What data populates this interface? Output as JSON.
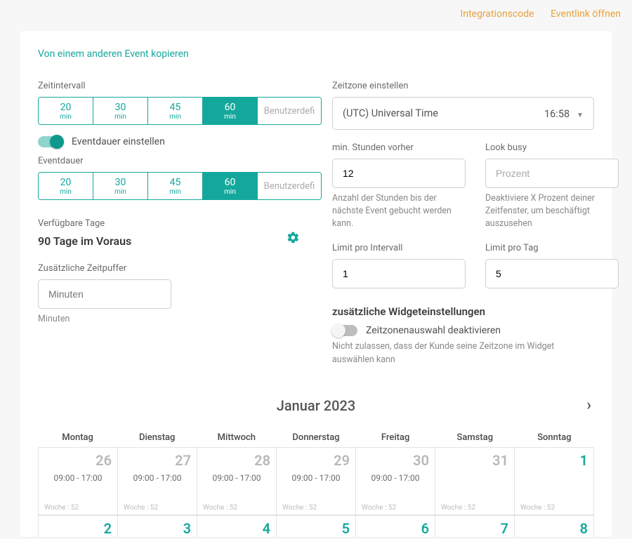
{
  "topLinks": {
    "integration": "Integrationscode",
    "openLink": "Eventlink öffnen"
  },
  "copyFrom": "Von einem anderen Event kopieren",
  "left": {
    "intervalLabel": "Zeitintervall",
    "intervalOptions": [
      "20",
      "30",
      "45",
      "60"
    ],
    "intervalSelected": 3,
    "minUnit": "min",
    "customLabel": "Benutzerdefi",
    "setDurationToggle": "Eventdauer einstellen",
    "durationLabel": "Eventdauer",
    "durationOptions": [
      "20",
      "30",
      "45",
      "60"
    ],
    "durationSelected": 3,
    "availLabel": "Verfügbare Tage",
    "availValue": "90 Tage im Voraus",
    "bufferLabel": "Zusätzliche Zeitpuffer",
    "bufferPlaceholder": "Minuten",
    "bufferSub": "Minuten"
  },
  "right": {
    "tzLabel": "Zeitzone einstellen",
    "tzValue": "(UTC) Universal Time",
    "tzTime": "16:58",
    "minHoursLabel": "min. Stunden vorher",
    "minHoursValue": "12",
    "minHoursHelp": "Anzahl der Stunden bis der nächste Event gebucht werden kann.",
    "lookBusyLabel": "Look busy",
    "lookBusyPlaceholder": "Prozent",
    "lookBusyHelp": "Deaktiviere X Prozent deiner Zeitfenster, um beschäftigt auszusehen",
    "limitIntLabel": "Limit pro Intervall",
    "limitIntValue": "1",
    "limitDayLabel": "Limit pro Tag",
    "limitDayValue": "5",
    "widgetSettings": "zusätzliche Widgeteinstellungen",
    "disableTzToggle": "Zeitzonenauswahl deaktivieren",
    "disableTzHelp": "Nicht zulassen, dass der Kunde seine Zeitzone im Widget auswählen kann"
  },
  "calendar": {
    "title": "Januar 2023",
    "dow": [
      "Montag",
      "Dienstag",
      "Mittwoch",
      "Donnerstag",
      "Freitag",
      "Samstag",
      "Sonntag"
    ],
    "week1": [
      {
        "d": "26",
        "prev": true,
        "hours": "09:00 - 17:00",
        "wk": "Woche : 52"
      },
      {
        "d": "27",
        "prev": true,
        "hours": "09:00 - 17:00",
        "wk": "Woche : 52"
      },
      {
        "d": "28",
        "prev": true,
        "hours": "09:00 - 17:00",
        "wk": "Woche : 52"
      },
      {
        "d": "29",
        "prev": true,
        "hours": "09:00 - 17:00",
        "wk": "Woche : 52"
      },
      {
        "d": "30",
        "prev": true,
        "hours": "09:00 - 17:00",
        "wk": "Woche : 52"
      },
      {
        "d": "31",
        "prev": true,
        "hours": "",
        "wk": "Woche : 52"
      },
      {
        "d": "1",
        "prev": false,
        "hours": "",
        "wk": "Woche : 52"
      }
    ],
    "week2": [
      "2",
      "3",
      "4",
      "5",
      "6",
      "7",
      "8"
    ]
  }
}
